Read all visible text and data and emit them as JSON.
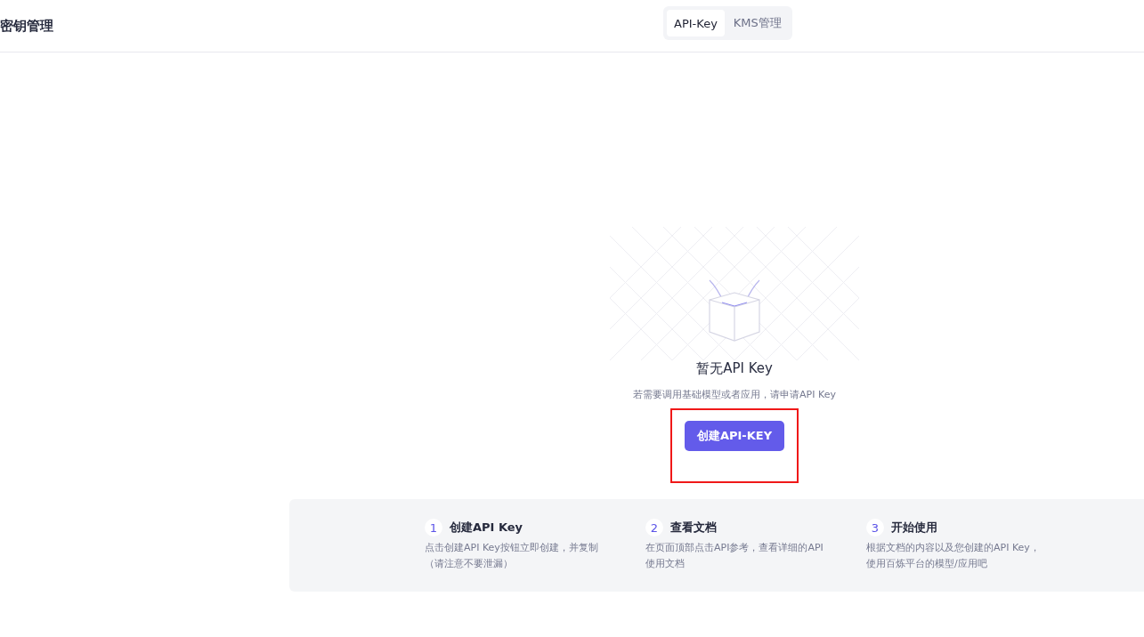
{
  "header": {
    "title": "密钥管理"
  },
  "tabs": [
    {
      "label": "API-Key",
      "selected": true
    },
    {
      "label": "KMS管理",
      "selected": false
    }
  ],
  "empty_state": {
    "title": "暂无API Key",
    "description": "若需要调用基础模型或者应用，请申请API Key",
    "button": "创建API-KEY",
    "highlighted": true
  },
  "steps": [
    {
      "number": "1",
      "title": "创建API Key",
      "text": "点击创建API Key按钮立即创建，并复制（请注意不要泄漏）"
    },
    {
      "number": "2",
      "title": "查看文档",
      "text": "在页面顶部点击API参考，查看详细的API使用文档"
    },
    {
      "number": "3",
      "title": "开始使用",
      "text": "根据文档的内容以及您创建的API Key，使用百炼平台的模型/应用吧"
    }
  ]
}
